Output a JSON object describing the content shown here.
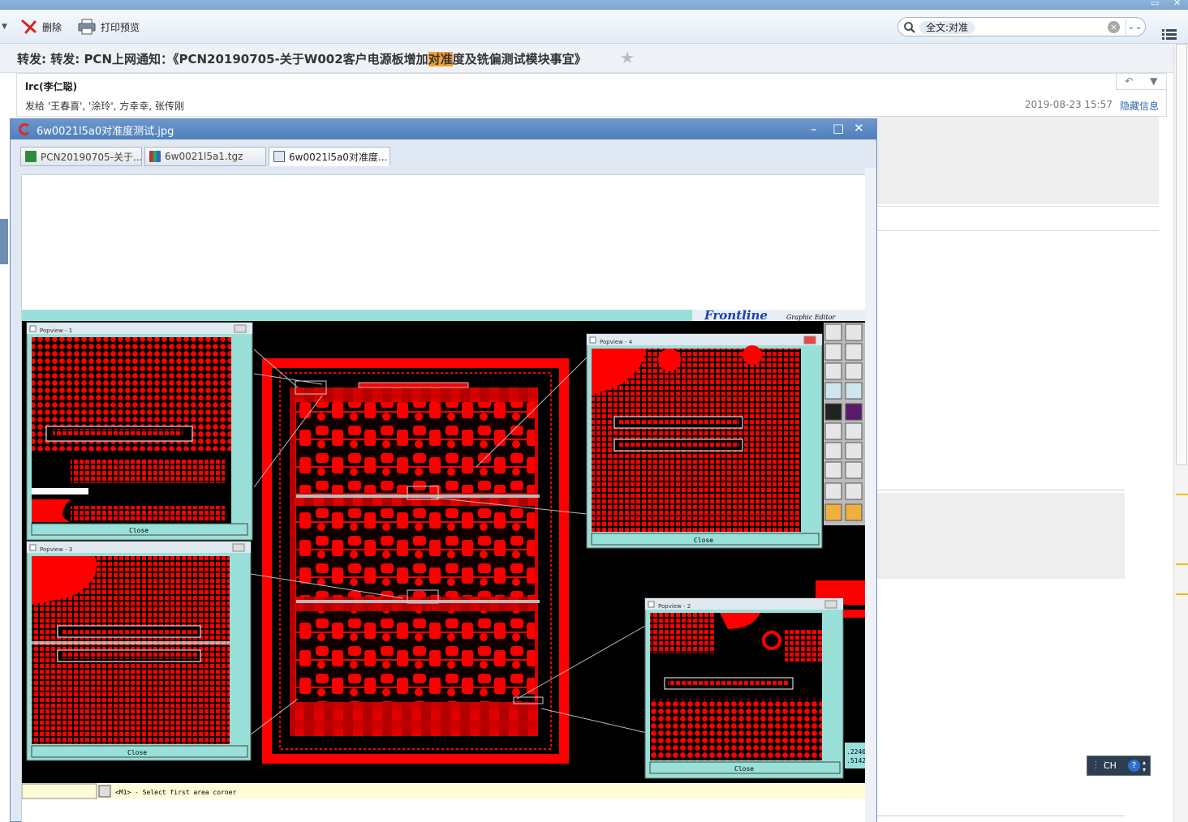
{
  "toolbar": {
    "delete_label": "删除",
    "print_preview_label": "打印预览",
    "search_value": "全文:对准"
  },
  "mail": {
    "subject_prefix": "转发: 转发: PCN上网通知：《PCN20190705-关于W002客户电源板增加",
    "subject_highlight": "对准",
    "subject_suffix": "度及铣偏测试模块事宜》",
    "sender": "lrc(李仁聪)",
    "recipients": "发给 '王春喜', '涂玲', 方幸幸, 张传刚",
    "date": "2019-08-23 15:57",
    "hide_info_label": "隐藏信息"
  },
  "viewer": {
    "title": "6w0021l5a0对准度测试.jpg",
    "tabs": [
      {
        "label": "PCN20190705-关于...",
        "icon": "excel-file-icon"
      },
      {
        "label": "6w0021l5a1.tgz",
        "icon": "archive-file-icon"
      },
      {
        "label": "6w0021l5a0对准度...",
        "icon": "image-file-icon"
      }
    ]
  },
  "cad": {
    "brand": "Frontline",
    "subtitle": "Graphic Editor",
    "popviews": [
      {
        "title": "Popview - 1",
        "close": "Close"
      },
      {
        "title": "Popview - 4",
        "close": "Close"
      },
      {
        "title": "Popview - 3",
        "close": "Close"
      },
      {
        "title": "Popview - 2",
        "close": "Close"
      }
    ],
    "status_text": "<M1> - Select first area corner",
    "coord_1": ".2240",
    "coord_2": ".5142"
  },
  "ime": {
    "label": "CH"
  },
  "colors": {
    "pcb_red": "#ff0000",
    "pcb_bg": "#000000",
    "panel_teal": "#66ccaa",
    "titlebar_blue": "#5a88c4"
  }
}
